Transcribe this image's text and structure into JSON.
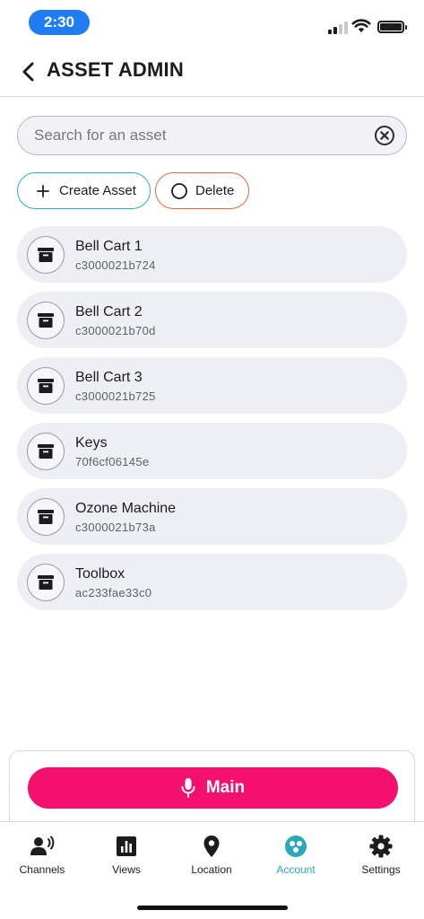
{
  "status_bar": {
    "time": "2:30"
  },
  "header": {
    "title": "ASSET ADMIN"
  },
  "search": {
    "placeholder": "Search for an asset",
    "value": ""
  },
  "actions": {
    "create_label": "Create Asset",
    "delete_label": "Delete"
  },
  "assets": [
    {
      "name": "Bell Cart 1",
      "id": "c3000021b724"
    },
    {
      "name": "Bell Cart 2",
      "id": "c3000021b70d"
    },
    {
      "name": "Bell Cart 3",
      "id": "c3000021b725"
    },
    {
      "name": "Keys",
      "id": "70f6cf06145e"
    },
    {
      "name": "Ozone Machine",
      "id": "c3000021b73a"
    },
    {
      "name": "Toolbox",
      "id": "ac233fae33c0"
    }
  ],
  "bottom": {
    "main_label": "Main"
  },
  "tabs": [
    {
      "label": "Channels",
      "icon": "channels-icon"
    },
    {
      "label": "Views",
      "icon": "bar-chart-icon"
    },
    {
      "label": "Location",
      "icon": "location-pin-icon"
    },
    {
      "label": "Account",
      "icon": "account-icon",
      "active": true
    },
    {
      "label": "Settings",
      "icon": "gear-icon"
    }
  ],
  "colors": {
    "time_pill": "#1f7cf2",
    "create_border": "#2ab0c4",
    "delete_border": "#e2683a",
    "main_button": "#f3106e",
    "active_tab": "#2aa7b8"
  }
}
